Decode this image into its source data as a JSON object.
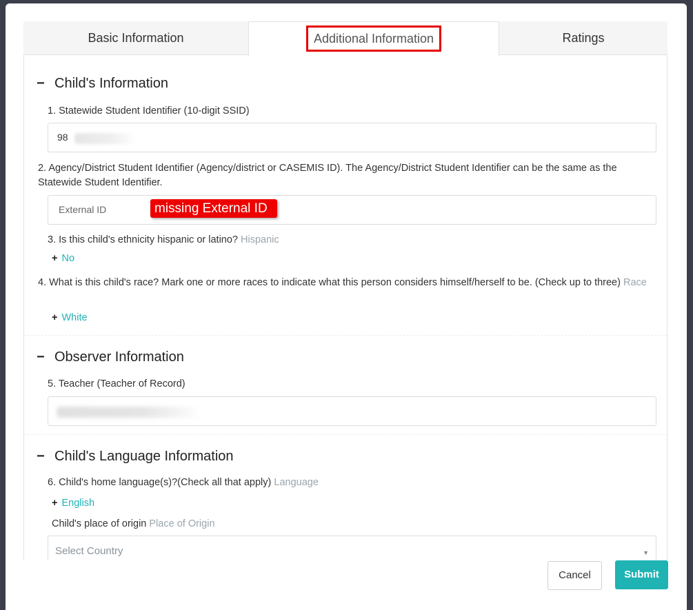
{
  "tabs": [
    {
      "label": "Basic Information"
    },
    {
      "label": "Additional Information"
    },
    {
      "label": "Ratings"
    }
  ],
  "sections": {
    "child_info": {
      "title": "Child's Information",
      "q1": {
        "label": "1.  Statewide Student Identifier (10-digit SSID)",
        "value": "98"
      },
      "q2": {
        "label": "2.  Agency/District Student Identifier (Agency/district or CASEMIS ID). The Agency/District Student Identifier can be the same as the Statewide Student Identifier.",
        "placeholder": "External ID",
        "annotation": "missing External ID"
      },
      "q3": {
        "label": "3.  Is this child's ethnicity hispanic or latino?",
        "hint": "Hispanic",
        "option": "No"
      },
      "q4": {
        "label": "4. What is this child's race? Mark one or more races to indicate what this person considers himself/herself to be. (Check up to three)",
        "hint": "Race",
        "option": "White"
      }
    },
    "observer_info": {
      "title": "Observer Information",
      "q5": {
        "label": "5.  Teacher (Teacher of Record)"
      }
    },
    "language_info": {
      "title": "Child's Language Information",
      "q6": {
        "label": "6. Child's home language(s)?(Check all that apply)",
        "hint": "Language",
        "option": "English"
      },
      "origin": {
        "label": "Child's place of origin",
        "hint": "Place of Origin",
        "placeholder": "Select Country"
      }
    }
  },
  "footer": {
    "cancel_label": "Cancel",
    "submit_label": "Submit"
  },
  "colors": {
    "accent": "#1fb3b3",
    "highlight": "#ee0000",
    "muted": "#9aa5ad"
  },
  "icons": {
    "collapse": "minus-icon",
    "add": "plus-icon",
    "dropdown": "caret-down-icon"
  }
}
